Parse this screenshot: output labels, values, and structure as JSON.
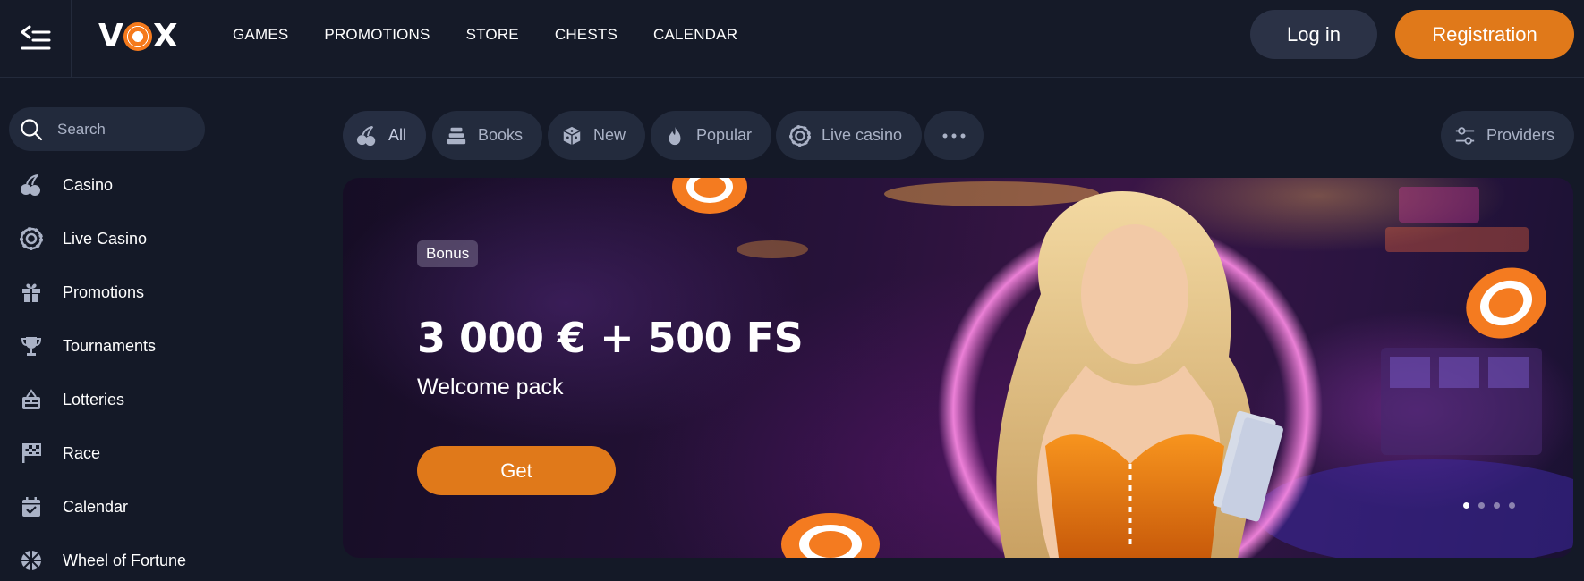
{
  "header": {
    "logo_text_left": "V",
    "logo_text_right": "X",
    "nav": [
      "GAMES",
      "PROMOTIONS",
      "STORE",
      "CHESTS",
      "CALENDAR"
    ],
    "login_label": "Log in",
    "register_label": "Registration"
  },
  "sidebar": {
    "search_placeholder": "Search",
    "items": [
      {
        "label": "Casino",
        "icon": "cherries-icon"
      },
      {
        "label": "Live Casino",
        "icon": "chip-icon"
      },
      {
        "label": "Promotions",
        "icon": "gift-icon"
      },
      {
        "label": "Tournaments",
        "icon": "trophy-icon"
      },
      {
        "label": "Lotteries",
        "icon": "lottery-icon"
      },
      {
        "label": "Race",
        "icon": "flag-icon"
      },
      {
        "label": "Calendar",
        "icon": "calendar-icon"
      },
      {
        "label": "Wheel of Fortune",
        "icon": "wheel-icon"
      }
    ]
  },
  "categories": [
    {
      "label": "All",
      "icon": "cherries-icon"
    },
    {
      "label": "Books",
      "icon": "books-icon"
    },
    {
      "label": "New",
      "icon": "dice-icon"
    },
    {
      "label": "Popular",
      "icon": "fire-icon"
    },
    {
      "label": "Live casino",
      "icon": "chip-icon"
    },
    {
      "label": "",
      "icon": "more-icon"
    }
  ],
  "providers_label": "Providers",
  "banner": {
    "tag": "Bonus",
    "title": "3 000 € + 500 FS",
    "subtitle": "Welcome pack",
    "cta": "Get",
    "slides": 4,
    "active_slide": 1
  },
  "colors": {
    "accent": "#e0791a",
    "background": "#141927",
    "chip": "#232b3d"
  }
}
